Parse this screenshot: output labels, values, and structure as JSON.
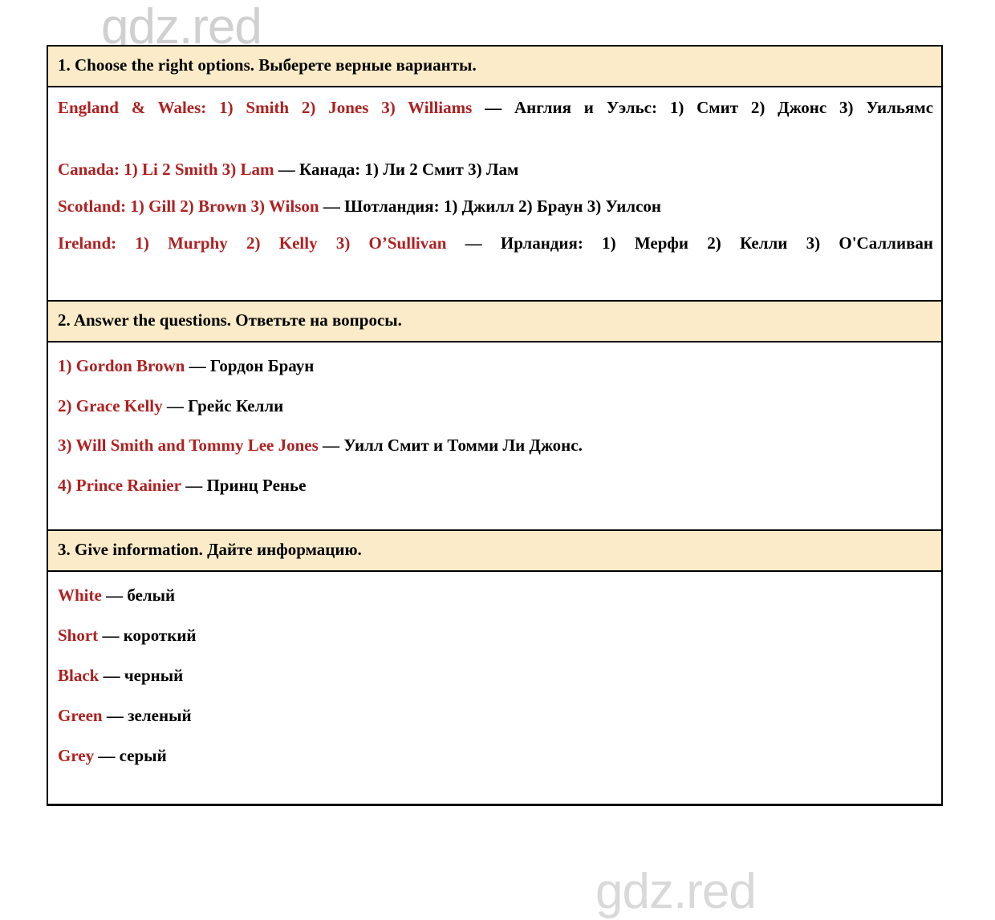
{
  "watermarks": {
    "text": "gdz.red",
    "color": "#c8c8c8",
    "occurrences": 5
  },
  "palette": {
    "header_background": "#fbebc8",
    "english_text": "#b02021",
    "russian_text": "#000000",
    "border": "#000000",
    "page_background": "#ffffff"
  },
  "sections": [
    {
      "id": "task-1",
      "header": "1. Choose the right options. Выберете верные варианты.",
      "lines": [
        {
          "english": "England & Wales: 1) Smith 2) Jones 3) Williams",
          "dash": "—",
          "russian": "Англия и Уэльс: 1) Смит 2) Джонс 3) Уильямс",
          "justified": true
        },
        {
          "english": "Canada: 1) Li 2 Smith 3) Lam",
          "dash": "—",
          "russian": "Канада: 1) Ли 2 Смит 3) Лам",
          "justified": false
        },
        {
          "english": "Scotland: 1) Gill 2) Brown 3) Wilson",
          "dash": "—",
          "russian": "Шотландия: 1) Джилл 2) Браун 3) Уилсон",
          "justified": false
        },
        {
          "english": "Ireland: 1) Murphy 2) Kelly 3) O’Sullivan",
          "dash": "—",
          "russian": "Ирландия: 1) Мерфи 2) Келли 3) О'Салливан",
          "justified": true
        }
      ]
    },
    {
      "id": "task-2",
      "header": "2. Answer the questions. Ответьте на вопросы.",
      "lines": [
        {
          "english": "1) Gordon Brown",
          "dash": "—",
          "russian": "Гордон Браун",
          "justified": false
        },
        {
          "english": "2) Grace Kelly",
          "dash": "—",
          "russian": "Грейс Келли",
          "justified": false
        },
        {
          "english": "3) Will Smith and Tommy Lee Jones",
          "dash": "—",
          "russian": "Уилл Смит и Томми Ли Джонс.",
          "justified": false
        },
        {
          "english": "4) Prince Rainier",
          "dash": "—",
          "russian": "Принц Ренье",
          "justified": false
        }
      ]
    },
    {
      "id": "task-3",
      "header": "3. Give information. Дайте информацию.",
      "lines": [
        {
          "english": "White",
          "dash": "—",
          "russian": "белый",
          "justified": false
        },
        {
          "english": "Short",
          "dash": "—",
          "russian": "короткий",
          "justified": false
        },
        {
          "english": "Black",
          "dash": "—",
          "russian": "черный",
          "justified": false
        },
        {
          "english": "Green",
          "dash": "—",
          "russian": "зеленый",
          "justified": false
        },
        {
          "english": "Grey",
          "dash": "—",
          "russian": "серый",
          "justified": false
        }
      ]
    }
  ]
}
